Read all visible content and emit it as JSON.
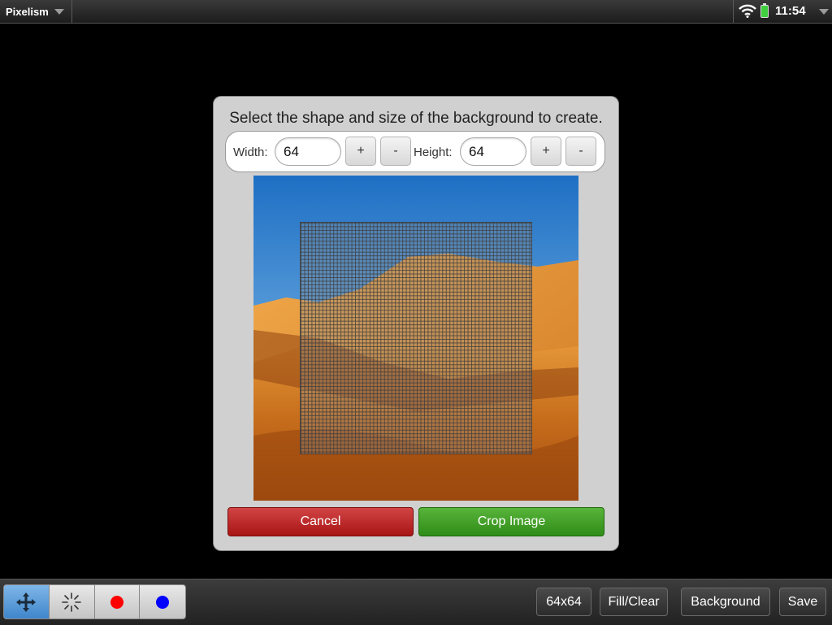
{
  "statusbar": {
    "app_title": "Pixelism",
    "clock": "11:54"
  },
  "dialog": {
    "title": "Select the shape and size of the background to create.",
    "width_label": "Width:",
    "width_value": "64",
    "height_label": "Height:",
    "height_value": "64",
    "plus_label": "+",
    "minus_label": "-",
    "cancel_label": "Cancel",
    "crop_label": "Crop Image",
    "grid_columns": 64,
    "grid_rows": 64
  },
  "toolbar": {
    "tools": [
      "move-tool",
      "sparkle-tool",
      "red-color",
      "blue-color"
    ],
    "size_label": "64x64",
    "fill_clear_label": "Fill/Clear",
    "background_label": "Background",
    "save_label": "Save"
  },
  "colors": {
    "cancel": "#b82020",
    "crop": "#3f9c22",
    "selected_tool": "#4a90d8",
    "primary_color": "#ff0000",
    "secondary_color": "#0000ff"
  }
}
